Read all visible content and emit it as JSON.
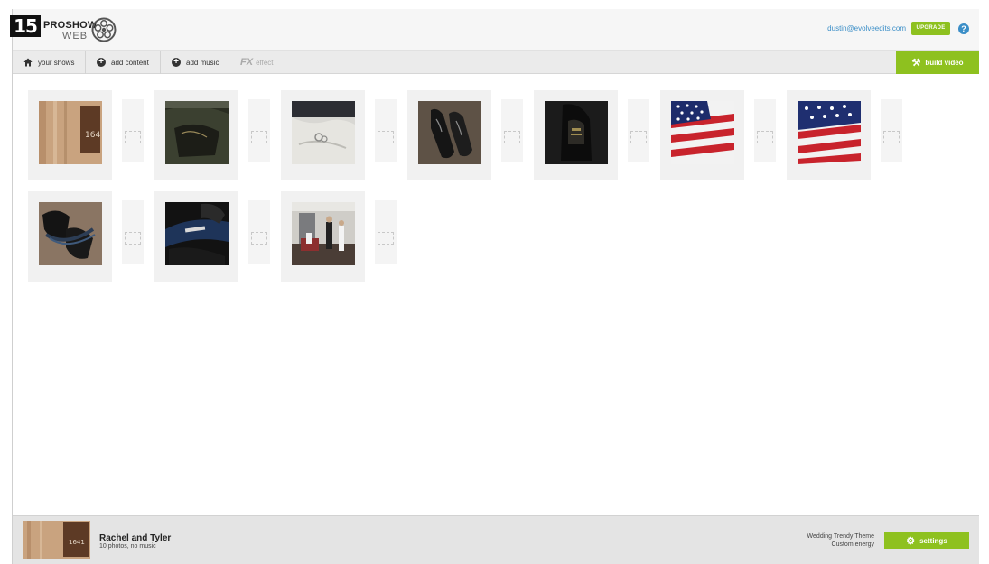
{
  "step_badge": "15",
  "logo": {
    "name": "PROSHOW",
    "sub": "WEB",
    "reel_icon": "film-reel-icon"
  },
  "header": {
    "user_email": "dustin@evolveedits.com",
    "upgrade_label": "UPGRADE",
    "help_label": "?"
  },
  "toolbar": {
    "your_shows": "your shows",
    "add_content": "add content",
    "add_music": "add music",
    "fx_mark": "FX",
    "effect": "effect",
    "build_video": "build video"
  },
  "slides": [
    {
      "subject": "hotel room door 164",
      "number_label": "164"
    },
    {
      "subject": "garment bag"
    },
    {
      "subject": "rings on fabric"
    },
    {
      "subject": "black dress shoes"
    },
    {
      "subject": "shoe close-up"
    },
    {
      "subject": "american flag"
    },
    {
      "subject": "american flag detail"
    },
    {
      "subject": "shoes and belt"
    },
    {
      "subject": "shoe label"
    },
    {
      "subject": "groomsmen in room"
    }
  ],
  "footer": {
    "show_title": "Rachel and Tyler",
    "show_subtitle": "10 photos, no music",
    "thumb_number": "1641",
    "theme_name": "Wedding Trendy Theme",
    "theme_energy": "Custom energy",
    "settings_label": "settings"
  },
  "colors": {
    "accent_green": "#8ec11f",
    "link_blue": "#3b8ec7"
  }
}
